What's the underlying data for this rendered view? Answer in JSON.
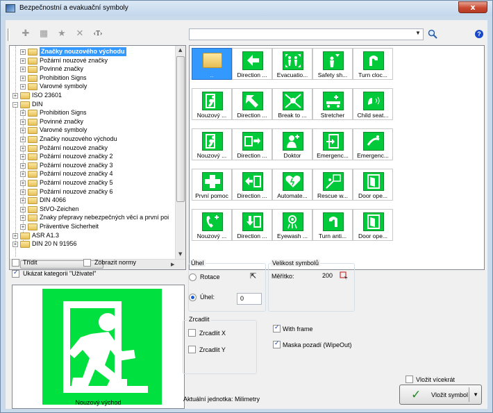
{
  "window": {
    "title": "Bezpečnostní a evakuační symboly",
    "close_glyph": "x"
  },
  "toolbar": {
    "btn_text": "‹T›"
  },
  "search": {
    "value": "",
    "placeholder": ""
  },
  "help": {
    "label": "?"
  },
  "tree": {
    "items": [
      {
        "label": "Značky nouzového východu",
        "selected": true
      },
      {
        "label": "Požární nouzové značky"
      },
      {
        "label": "Povinné značky"
      },
      {
        "label": "Prohibition Signs"
      },
      {
        "label": "Varovné symboly"
      },
      {
        "label": "ISO 23601"
      },
      {
        "label": "DIN"
      },
      {
        "label": "Prohibition Signs"
      },
      {
        "label": "Povinné značky"
      },
      {
        "label": "Varovné symboly"
      },
      {
        "label": "Značky nouzového východu"
      },
      {
        "label": "Požární nouzové značky"
      },
      {
        "label": "Požární nouzové značky 2"
      },
      {
        "label": "Požární nouzové značky 3"
      },
      {
        "label": "Požární nouzové značky 4"
      },
      {
        "label": "Požární nouzové značky 5"
      },
      {
        "label": "Požární nouzové značky 6"
      },
      {
        "label": "DIN 4066"
      },
      {
        "label": "StVO-Zeichen"
      },
      {
        "label": "Znaky přepravy nebezpečných věcí a první poi"
      },
      {
        "label": "Präventive Sicherheit"
      },
      {
        "label": "ASR A1.3"
      },
      {
        "label": "DIN 20 N 91956"
      }
    ]
  },
  "symbols": [
    {
      "label": "..",
      "selected": true,
      "icon": "folder-up-icon"
    },
    {
      "label": "Direction ...",
      "icon": "arrow-left-icon"
    },
    {
      "label": "Evacuatio...",
      "icon": "evacuation-point-icon"
    },
    {
      "label": "Safety sh...",
      "icon": "safety-shower-icon"
    },
    {
      "label": "Turn cloc...",
      "icon": "turn-clockwise-icon"
    },
    {
      "label": "Nouzový ...",
      "icon": "emergency-exit-icon"
    },
    {
      "label": "Direction ...",
      "icon": "arrow-up-left-icon"
    },
    {
      "label": "Break to ...",
      "icon": "break-to-obtain-access-icon"
    },
    {
      "label": "Stretcher",
      "icon": "stretcher-icon"
    },
    {
      "label": "Child seat...",
      "icon": "child-seat-icon"
    },
    {
      "label": "Nouzový ...",
      "icon": "emergency-exit-icon"
    },
    {
      "label": "Direction ...",
      "icon": "direction-exit-icon"
    },
    {
      "label": "Doktor",
      "icon": "doctor-icon"
    },
    {
      "label": "Emergenc...",
      "icon": "emergency-door-icon"
    },
    {
      "label": "Emergenc...",
      "icon": "emergency-eyewash-icon"
    },
    {
      "label": "První pomoc",
      "icon": "first-aid-icon"
    },
    {
      "label": "Direction ...",
      "icon": "direction-left-icon"
    },
    {
      "label": "Automate...",
      "icon": "defibrillator-icon"
    },
    {
      "label": "Rescue w...",
      "icon": "rescue-window-icon"
    },
    {
      "label": "Door ope...",
      "icon": "door-opens-icon"
    },
    {
      "label": "Nouzový ...",
      "icon": "emergency-phone-icon"
    },
    {
      "label": "Direction ...",
      "icon": "direction-down-icon"
    },
    {
      "label": "Eyewash ...",
      "icon": "eyewash-icon"
    },
    {
      "label": "Turn anti...",
      "icon": "turn-anticlockwise-icon"
    },
    {
      "label": "Door ope...",
      "icon": "door-opens-icon"
    }
  ],
  "options": {
    "sort_label": "Třídit",
    "sort_checked": false,
    "show_norms_label": "Zobrazit normy",
    "show_norms_checked": false,
    "show_category_label": "Ukázat kategorii \"Uživatel\"",
    "show_category_checked": true
  },
  "preview": {
    "caption": "Nouzový východ",
    "sign_color": "#00e13f"
  },
  "angle": {
    "group_title": "Úhel",
    "rotation_label": "Rotace",
    "rotation_selected": false,
    "angle_label": "Úhel:",
    "angle_selected": true,
    "angle_value": "0"
  },
  "size": {
    "group_title": "Velikost symbolů",
    "scale_label": "Měřítko:",
    "scale_value": "200"
  },
  "mirror": {
    "group_title": "Zrcadlit",
    "mirror_x_label": "Zrcadlit X",
    "mirror_x_checked": false,
    "mirror_y_label": "Zrcadlit Y",
    "mirror_y_checked": false
  },
  "frame": {
    "with_frame_label": "With frame",
    "with_frame_checked": true,
    "mask_label": "Maska pozadí (WipeOut)",
    "mask_checked": true
  },
  "units": {
    "label": "Aktuální jednotka: Milimetry"
  },
  "insert": {
    "multi_label": "Vložit vícekrát",
    "multi_checked": false,
    "button_label": "Vložit symbol"
  },
  "colors": {
    "symbol_green": "#00c93a",
    "selection": "#3399ff",
    "folder": "#e8c25a"
  }
}
